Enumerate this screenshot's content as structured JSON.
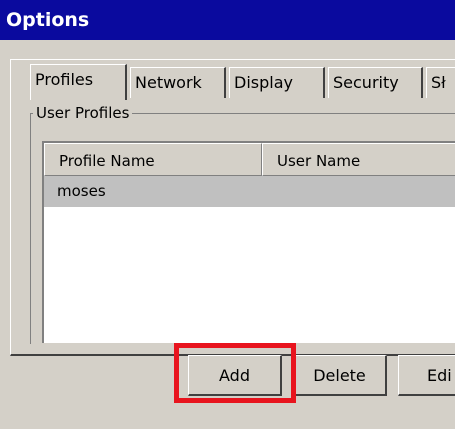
{
  "window": {
    "title": "Options"
  },
  "tabs": [
    {
      "label": "Profiles",
      "active": true
    },
    {
      "label": "Network"
    },
    {
      "label": "Display"
    },
    {
      "label": "Security"
    },
    {
      "label": "Sł"
    }
  ],
  "group": {
    "label": "User Profiles"
  },
  "listview": {
    "columns": [
      "Profile Name",
      "User Name"
    ],
    "rows": [
      {
        "profile_name": "moses",
        "user_name": ""
      }
    ]
  },
  "buttons": {
    "add": "Add",
    "delete": "Delete",
    "edit": "Edi"
  },
  "colors": {
    "title_bar": "#0a0a9e",
    "face": "#d4d0c8",
    "selected_row": "#c0c0c0",
    "highlight": "#e8141e"
  }
}
